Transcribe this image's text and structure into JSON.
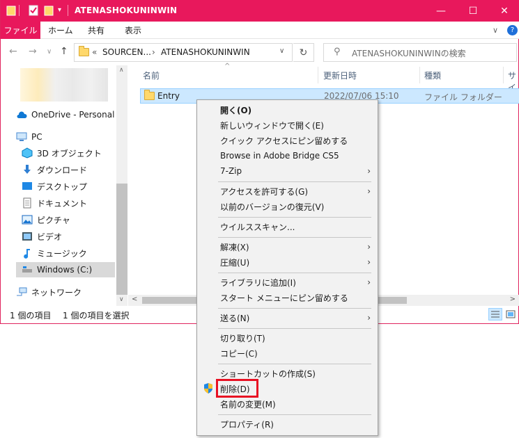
{
  "window": {
    "title": "ATENASHOKUNINWIN",
    "minimize_glyph": "—",
    "maximize_glyph": "☐",
    "close_glyph": "✕"
  },
  "ribbon": {
    "tabs": [
      "ファイル",
      "ホーム",
      "共有",
      "表示"
    ],
    "expand_glyph": "∨",
    "help_glyph": "?"
  },
  "address": {
    "overflow": "«",
    "crumb1": "SOURCEN...",
    "sep": "›",
    "crumb2": "ATENASHOKUNINWIN",
    "dropdown": "∨",
    "search_placeholder": "ATENASHOKUNINWINの検索"
  },
  "nav": {
    "onedrive": "OneDrive - Personal",
    "pc": "PC",
    "items": [
      "3D オブジェクト",
      "ダウンロード",
      "デスクトップ",
      "ドキュメント",
      "ピクチャ",
      "ビデオ",
      "ミュージック",
      "Windows (C:)"
    ],
    "network": "ネットワーク"
  },
  "columns": {
    "name": "名前",
    "modified": "更新日時",
    "type": "種類",
    "size": "サイ"
  },
  "files": [
    {
      "name": "Entry",
      "modified": "2022/07/06 15:10",
      "type": "ファイル フォルダー"
    }
  ],
  "status": {
    "count": "1 個の項目",
    "selected": "1 個の項目を選択"
  },
  "context_menu": {
    "items": [
      {
        "label": "開く(O)",
        "bold": true
      },
      {
        "label": "新しいウィンドウで開く(E)"
      },
      {
        "label": "クイック アクセスにピン留めする"
      },
      {
        "label": "Browse in Adobe Bridge CS5"
      },
      {
        "label": "7-Zip",
        "submenu": true
      },
      {
        "label": "アクセスを許可する(G)",
        "submenu": true
      },
      {
        "label": "以前のバージョンの復元(V)"
      },
      {
        "label": "ウイルススキャン..."
      },
      {
        "label": "解凍(X)",
        "submenu": true
      },
      {
        "label": "圧縮(U)",
        "submenu": true
      },
      {
        "label": "ライブラリに追加(I)",
        "submenu": true
      },
      {
        "label": "スタート メニューにピン留めする"
      },
      {
        "label": "送る(N)",
        "submenu": true
      },
      {
        "label": "切り取り(T)"
      },
      {
        "label": "コピー(C)"
      },
      {
        "label": "ショートカットの作成(S)"
      },
      {
        "label": "削除(D)",
        "shield": true
      },
      {
        "label": "名前の変更(M)"
      },
      {
        "label": "プロパティ(R)"
      }
    ],
    "submenu_glyph": "›"
  },
  "colors": {
    "accent": "#e8185c",
    "selection": "#cce8ff",
    "highlight_box": "#e81123"
  }
}
